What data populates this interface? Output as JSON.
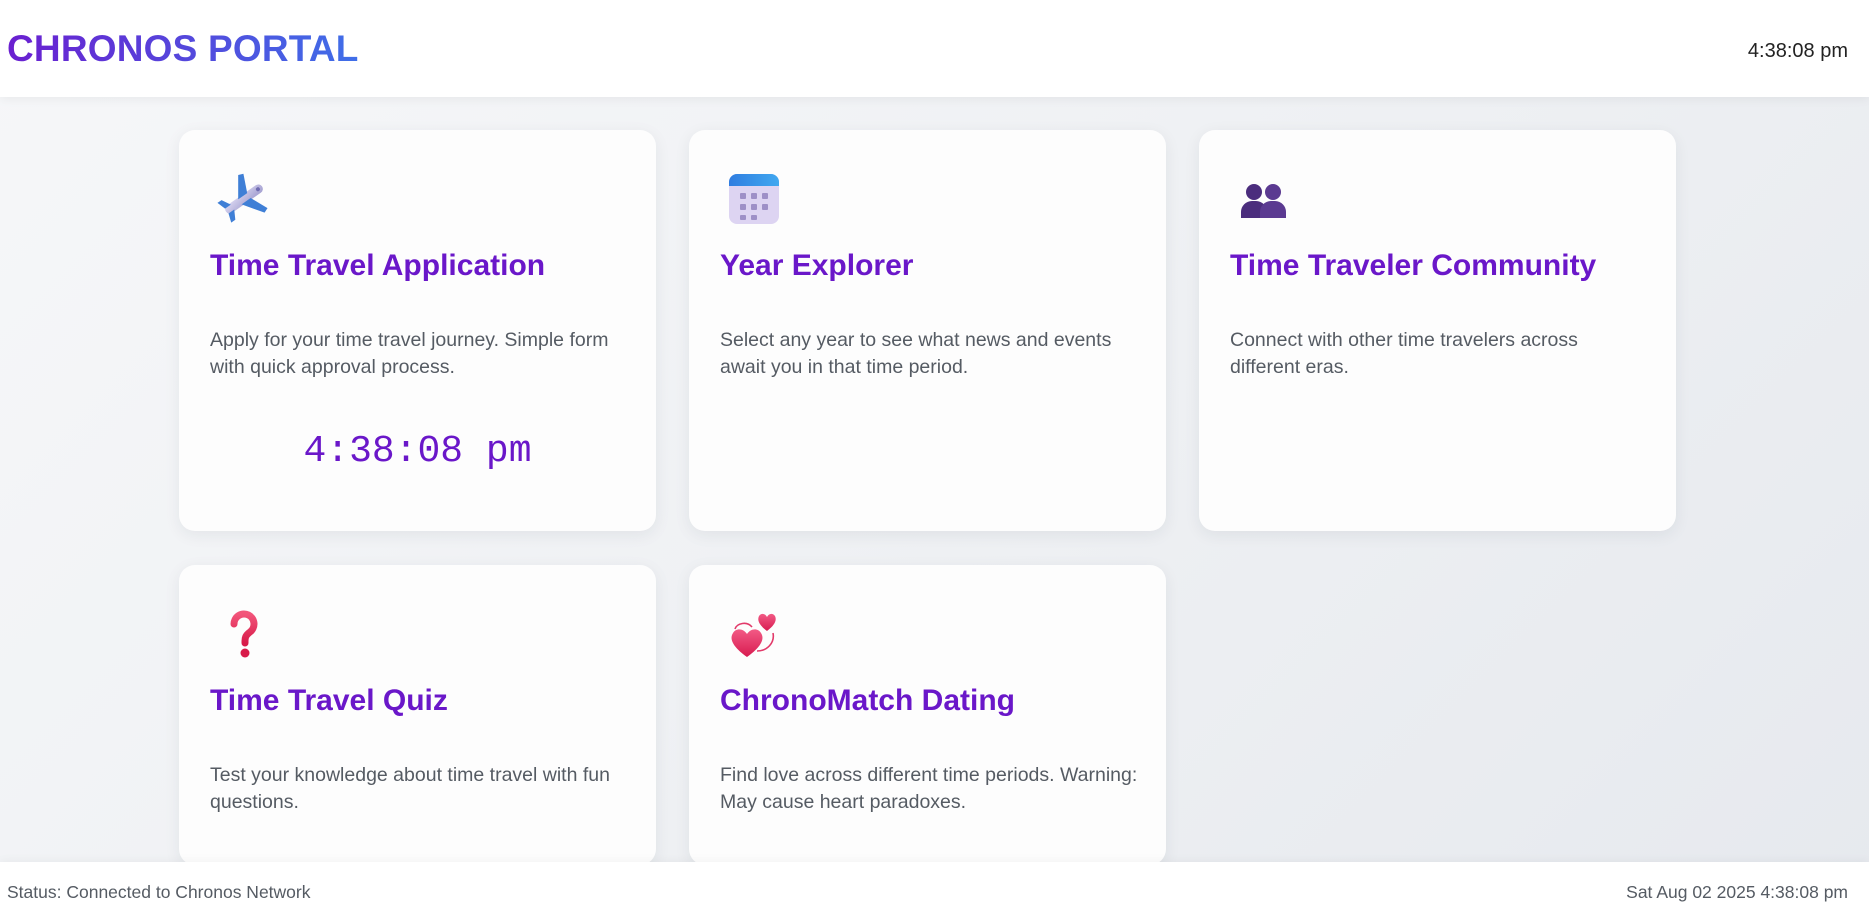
{
  "header": {
    "title": "CHRONOS PORTAL",
    "clock": "4:38:08 pm"
  },
  "cards": [
    {
      "icon": "airplane-icon",
      "title": "Time Travel Application",
      "description": "Apply for your time travel journey. Simple form with quick approval process.",
      "clock": "4:38:08 pm"
    },
    {
      "icon": "calendar-icon",
      "title": "Year Explorer",
      "description": "Select any year to see what news and events await you in that time period."
    },
    {
      "icon": "people-icon",
      "title": "Time Traveler Community",
      "description": "Connect with other time travelers across different eras."
    },
    {
      "icon": "question-mark-icon",
      "title": "Time Travel Quiz",
      "description": "Test your knowledge about time travel with fun questions."
    },
    {
      "icon": "two-hearts-icon",
      "title": "ChronoMatch Dating",
      "description": "Find love across different time periods. Warning: May cause heart paradoxes."
    }
  ],
  "footer": {
    "status": "Status: Connected to Chronos Network",
    "datetime": "Sat Aug 02 2025 4:38:08 pm"
  },
  "colors": {
    "accent_purple": "#6a17c9",
    "brand_gradient_start": "#6a1fd0",
    "brand_gradient_end": "#3f6fe8",
    "body_text": "#555b63",
    "card_background": "#fdfdfd"
  }
}
